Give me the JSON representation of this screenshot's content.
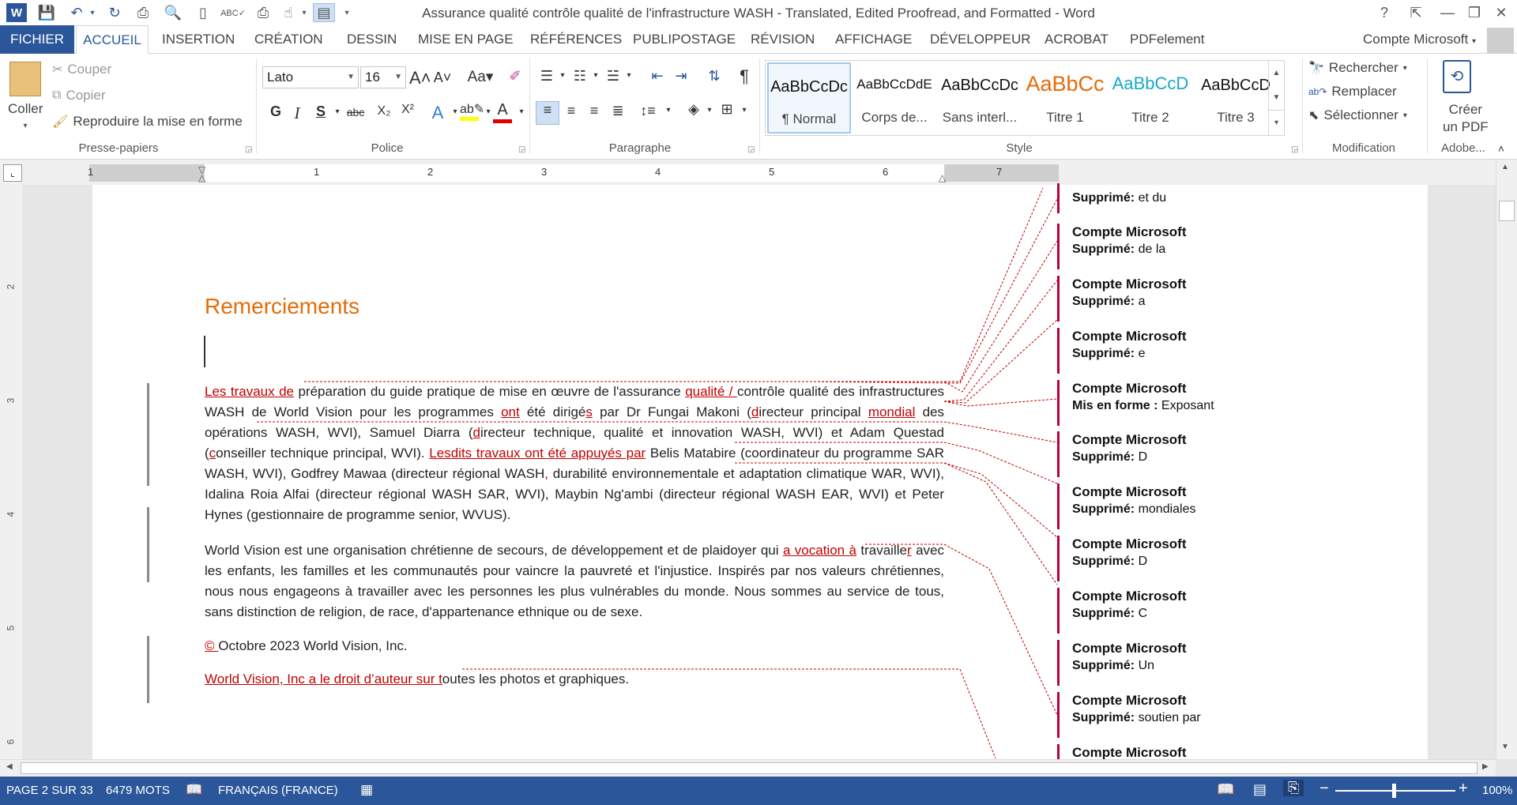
{
  "window": {
    "title": "Assurance qualité  contrôle qualité de l'infrastructure WASH - Translated, Edited Proofread, and Formatted - Word",
    "controls": {
      "help": "?",
      "ribbon_display": "⇱",
      "minimize": "—",
      "restore": "❐",
      "close": "✕"
    }
  },
  "tabs": [
    {
      "label": "FICHIER"
    },
    {
      "label": "ACCUEIL"
    },
    {
      "label": "INSERTION"
    },
    {
      "label": "CRÉATION"
    },
    {
      "label": "DESSIN"
    },
    {
      "label": "MISE EN PAGE"
    },
    {
      "label": "RÉFÉRENCES"
    },
    {
      "label": "PUBLIPOSTAGE"
    },
    {
      "label": "RÉVISION"
    },
    {
      "label": "AFFICHAGE"
    },
    {
      "label": "DÉVELOPPEUR"
    },
    {
      "label": "ACROBAT"
    },
    {
      "label": "PDFelement"
    }
  ],
  "account": "Compte Microsoft",
  "ribbon": {
    "clipboard": {
      "paste": "Coller",
      "cut": "Couper",
      "copy": "Copier",
      "format_painter": "Reproduire la mise en forme",
      "label": "Presse-papiers"
    },
    "font": {
      "name": "Lato",
      "size": "16",
      "label": "Police",
      "bold": "G",
      "italic": "I",
      "underline": "S",
      "strike": "abc",
      "sub": "X₂",
      "sup": "X²",
      "case": "Aa"
    },
    "paragraph": {
      "label": "Paragraphe"
    },
    "styles": {
      "label": "Style",
      "items": [
        {
          "preview": "AaBbCcDc",
          "name": "¶ Normal"
        },
        {
          "preview": "AaBbCcDdE",
          "name": "Corps de..."
        },
        {
          "preview": "AaBbCcDc",
          "name": "Sans interl..."
        },
        {
          "preview": "AaBbCc",
          "name": "Titre 1"
        },
        {
          "preview": "AaBbCcD",
          "name": "Titre 2"
        },
        {
          "preview": "AaBbCcD",
          "name": "Titre 3"
        }
      ]
    },
    "editing": {
      "find": "Rechercher",
      "replace": "Remplacer",
      "select": "Sélectionner",
      "label": "Modification"
    },
    "adobe": {
      "create_pdf_1": "Créer",
      "create_pdf_2": "un PDF",
      "label": "Adobe..."
    }
  },
  "colors": {
    "accent": "#2b579a",
    "revision": "#c00000",
    "heading": "#e36c09",
    "comment_bar": "#b8003c"
  },
  "ruler": {
    "marks": [
      "1",
      "1",
      "2",
      "3",
      "4",
      "5",
      "6",
      "7"
    ],
    "vertical": [
      "2",
      "3",
      "4",
      "5",
      "6"
    ]
  },
  "document": {
    "heading": "Remerciements",
    "p1": [
      {
        "t": "Les travaux de",
        "ins": true
      },
      {
        "t": " préparation du guide pratique de mise en œuvre de l'assurance "
      },
      {
        "t": "qualité / ",
        "ins": true
      },
      {
        "t": "contrôle qualité des infrastructures WASH de World Vision pour les programmes "
      },
      {
        "t": "ont",
        "ins": true
      },
      {
        "t": " été dirigé"
      },
      {
        "t": "s",
        "ins": true
      },
      {
        "t": " par Dr Fungai Makoni ("
      },
      {
        "t": "d",
        "ins": true
      },
      {
        "t": "irecteur principal "
      },
      {
        "t": "mondial",
        "ins": true
      },
      {
        "t": " des opérations WASH, WVI), Samuel Diarra ("
      },
      {
        "t": "d",
        "ins": true
      },
      {
        "t": "irecteur technique, qualité et innovation WASH, WVI) et Adam Questad ("
      },
      {
        "t": "c",
        "ins": true
      },
      {
        "t": "onseiller technique principal, WVI). "
      },
      {
        "t": "Lesdits travaux ont été appuyés par",
        "ins": true
      },
      {
        "t": " Belis Matabire (coordinateur du programme SAR WASH, WVI), Godfrey Mawaa (directeur régional WASH"
      },
      {
        "t": ",",
        "ins": true
      },
      {
        "t": " durabilité environnementale et adaptation climatique WAR, WVI), Idalina Roia Alfai (directeur régional WASH SAR, WVI), Maybin Ng'ambi (directeur régional WASH EAR, WVI) et Peter Hynes (gestionnaire de programme senior, WVUS)."
      }
    ],
    "p2": [
      {
        "t": "World Vision est une organisation chrétienne de secours, de développement et de plaidoyer qui "
      },
      {
        "t": "a vocation à",
        "ins": true
      },
      {
        "t": " travaille"
      },
      {
        "t": "r",
        "ins": true
      },
      {
        "t": " avec les enfants, les familles et les communautés pour vaincre la pauvreté et l'injustice. Inspirés par nos valeurs chrétiennes, nous nous engageons à travailler avec les personnes les plus vulnérables du monde. Nous sommes au service de tous, sans distinction de religion, de race, d'appartenance ethnique ou de sexe."
      }
    ],
    "p3": [
      {
        "t": "© ",
        "ins": true
      },
      {
        "t": "Octobre 2023 World Vision, Inc."
      }
    ],
    "p4": [
      {
        "t": "World Vision, Inc a le droit d’auteur sur t",
        "ins": true
      },
      {
        "t": "outes les photos et graphiques."
      }
    ]
  },
  "comments": [
    {
      "author": "Compte Microsoft",
      "type": "Supprimé:",
      "text": "et du"
    },
    {
      "author": "Compte Microsoft",
      "type": "Supprimé:",
      "text": " de la"
    },
    {
      "author": "Compte Microsoft",
      "type": "Supprimé:",
      "text": "a"
    },
    {
      "author": "Compte Microsoft",
      "type": "Supprimé:",
      "text": "e"
    },
    {
      "author": "Compte Microsoft",
      "type": "Mis en forme :",
      "text": "Exposant"
    },
    {
      "author": "Compte Microsoft",
      "type": "Supprimé:",
      "text": "D"
    },
    {
      "author": "Compte Microsoft",
      "type": "Supprimé:",
      "text": " mondiales"
    },
    {
      "author": "Compte Microsoft",
      "type": "Supprimé:",
      "text": "D"
    },
    {
      "author": "Compte Microsoft",
      "type": "Supprimé:",
      "text": "C"
    },
    {
      "author": "Compte Microsoft",
      "type": "Supprimé:",
      "text": "Un"
    },
    {
      "author": "Compte Microsoft",
      "type": "Supprimé:",
      "text": "soutien par"
    },
    {
      "author": "Compte Microsoft",
      "type": "",
      "text": ""
    }
  ],
  "status": {
    "page": "PAGE 2 SUR 33",
    "words": "6479 MOTS",
    "language": "FRANÇAIS (FRANCE)",
    "zoom": "100%",
    "zoom_minus": "−",
    "zoom_plus": "+"
  }
}
